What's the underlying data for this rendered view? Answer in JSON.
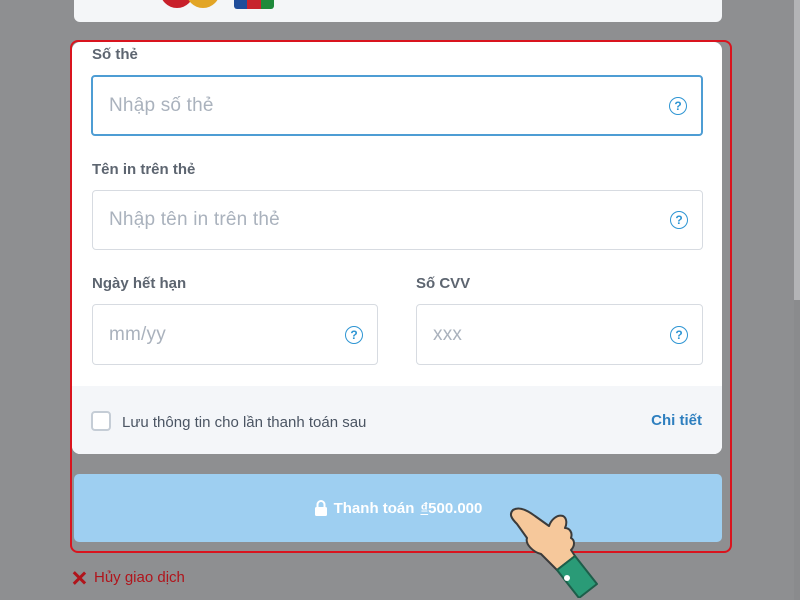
{
  "payment_form": {
    "card_number": {
      "label": "Số thẻ",
      "placeholder": "Nhập số thẻ"
    },
    "cardholder_name": {
      "label": "Tên in trên thẻ",
      "placeholder": "Nhập tên in trên thẻ"
    },
    "expiry": {
      "label": "Ngày hết hạn",
      "placeholder": "mm/yy"
    },
    "cvv": {
      "label": "Số CVV",
      "placeholder": "xxx"
    },
    "help_glyph": "?",
    "save_info": {
      "label": "Lưu thông tin cho lần thanh toán sau",
      "checked": false
    },
    "details_link": "Chi tiết"
  },
  "pay_button": {
    "label": "Thanh toán",
    "currency_symbol": "₫",
    "amount": "500.000"
  },
  "cancel_link": "Hủy giao dịch",
  "icons": [
    "help-icon",
    "lock-icon",
    "close-icon",
    "hand-pointer-icon"
  ],
  "colors": {
    "accent": "#2e95d3",
    "pay_button": "#9ecff1",
    "highlight": "#d9141e",
    "cancel": "#b0141b"
  }
}
